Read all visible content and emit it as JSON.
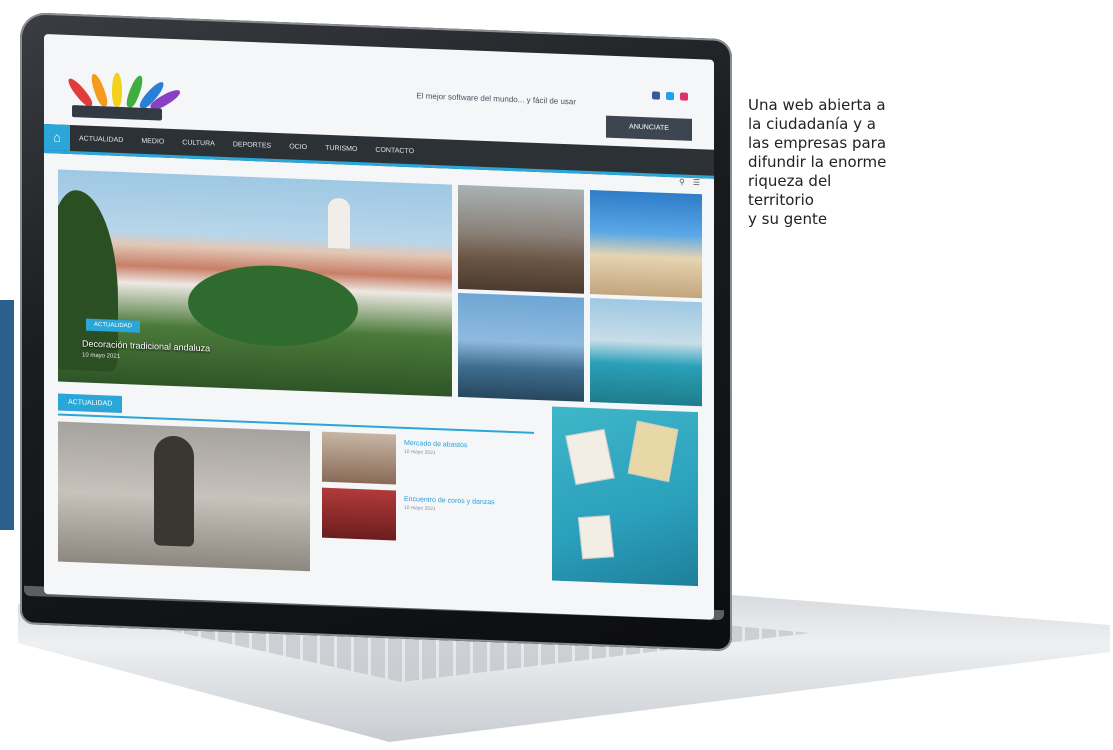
{
  "caption": {
    "lines": [
      "Una web abierta a",
      "la ciudadanía y a",
      "las empresas para",
      "difundir la enorme",
      "riqueza del",
      "territorio",
      "y su gente"
    ]
  },
  "site": {
    "tagline": "El mejor software del mundo... y fácil de usar",
    "cta_label": "ANUNCIATE",
    "nav": {
      "home_icon": "home-icon",
      "items": [
        "ACTUALIDAD",
        "MEDIO",
        "CULTURA",
        "DEPORTES",
        "OCIO",
        "TURISMO",
        "CONTACTO"
      ]
    },
    "hero": {
      "badge": "ACTUALIDAD",
      "title": "Decoración tradicional andaluza",
      "meta": "10 mayo 2021"
    },
    "section_label": "ACTUALIDAD",
    "news": [
      {
        "title": "Mercado de abastos",
        "date": "10 mayo 2021"
      },
      {
        "title": "Encuentro de coros y danzas",
        "date": "10 mayo 2021"
      }
    ],
    "colors": {
      "accent": "#2aa6d8",
      "nav_bg": "#2c3136",
      "side_band": "#2a5f8e"
    }
  }
}
